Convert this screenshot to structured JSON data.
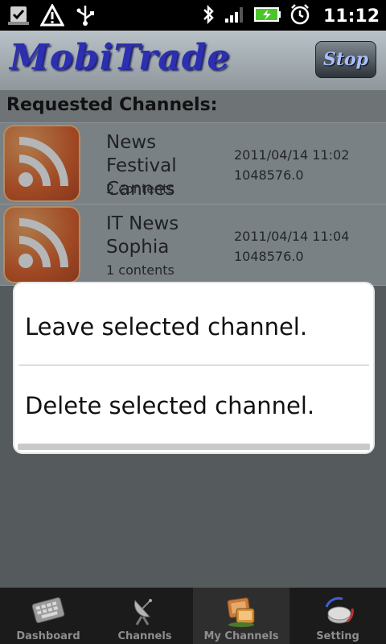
{
  "status": {
    "time": "11:12"
  },
  "header": {
    "app_title": "MobiTrade",
    "stop_label": "Stop"
  },
  "section_title": "Requested Channels:",
  "channels": [
    {
      "name": "News Festival Cannes",
      "count": "2 contents",
      "date": "2011/04/14 11:02",
      "size": "1048576.0"
    },
    {
      "name": "IT News Sophia",
      "count": "1 contents",
      "date": "2011/04/14 11:04",
      "size": "1048576.0"
    }
  ],
  "dialog": {
    "items": [
      "Leave selected channel.",
      "Delete selected channel."
    ]
  },
  "tabs": [
    {
      "label": "Dashboard"
    },
    {
      "label": "Channels"
    },
    {
      "label": "My Channels"
    },
    {
      "label": "Setting"
    }
  ],
  "colors": {
    "accent_logo": "#2c2fb1",
    "rss_orange": "#e0571d",
    "battery_green": "#4cc52b"
  },
  "icons": [
    "task-check-icon",
    "warning-icon",
    "usb-icon",
    "bluetooth-icon",
    "signal-icon",
    "battery-icon",
    "alarm-clock-icon",
    "rss-icon",
    "keyboard-icon",
    "satellite-dish-icon",
    "tv-icon",
    "settings-icon"
  ]
}
